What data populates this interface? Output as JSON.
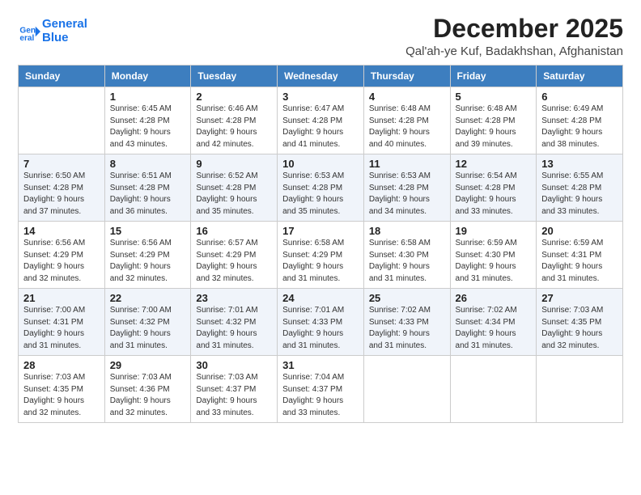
{
  "header": {
    "logo_line1": "General",
    "logo_line2": "Blue",
    "title": "December 2025",
    "subtitle": "Qal'ah-ye Kuf, Badakhshan, Afghanistan"
  },
  "days_of_week": [
    "Sunday",
    "Monday",
    "Tuesday",
    "Wednesday",
    "Thursday",
    "Friday",
    "Saturday"
  ],
  "weeks": [
    [
      {
        "day": "",
        "info": ""
      },
      {
        "day": "1",
        "info": "Sunrise: 6:45 AM\nSunset: 4:28 PM\nDaylight: 9 hours\nand 43 minutes."
      },
      {
        "day": "2",
        "info": "Sunrise: 6:46 AM\nSunset: 4:28 PM\nDaylight: 9 hours\nand 42 minutes."
      },
      {
        "day": "3",
        "info": "Sunrise: 6:47 AM\nSunset: 4:28 PM\nDaylight: 9 hours\nand 41 minutes."
      },
      {
        "day": "4",
        "info": "Sunrise: 6:48 AM\nSunset: 4:28 PM\nDaylight: 9 hours\nand 40 minutes."
      },
      {
        "day": "5",
        "info": "Sunrise: 6:48 AM\nSunset: 4:28 PM\nDaylight: 9 hours\nand 39 minutes."
      },
      {
        "day": "6",
        "info": "Sunrise: 6:49 AM\nSunset: 4:28 PM\nDaylight: 9 hours\nand 38 minutes."
      }
    ],
    [
      {
        "day": "7",
        "info": "Sunrise: 6:50 AM\nSunset: 4:28 PM\nDaylight: 9 hours\nand 37 minutes."
      },
      {
        "day": "8",
        "info": "Sunrise: 6:51 AM\nSunset: 4:28 PM\nDaylight: 9 hours\nand 36 minutes."
      },
      {
        "day": "9",
        "info": "Sunrise: 6:52 AM\nSunset: 4:28 PM\nDaylight: 9 hours\nand 35 minutes."
      },
      {
        "day": "10",
        "info": "Sunrise: 6:53 AM\nSunset: 4:28 PM\nDaylight: 9 hours\nand 35 minutes."
      },
      {
        "day": "11",
        "info": "Sunrise: 6:53 AM\nSunset: 4:28 PM\nDaylight: 9 hours\nand 34 minutes."
      },
      {
        "day": "12",
        "info": "Sunrise: 6:54 AM\nSunset: 4:28 PM\nDaylight: 9 hours\nand 33 minutes."
      },
      {
        "day": "13",
        "info": "Sunrise: 6:55 AM\nSunset: 4:28 PM\nDaylight: 9 hours\nand 33 minutes."
      }
    ],
    [
      {
        "day": "14",
        "info": "Sunrise: 6:56 AM\nSunset: 4:29 PM\nDaylight: 9 hours\nand 32 minutes."
      },
      {
        "day": "15",
        "info": "Sunrise: 6:56 AM\nSunset: 4:29 PM\nDaylight: 9 hours\nand 32 minutes."
      },
      {
        "day": "16",
        "info": "Sunrise: 6:57 AM\nSunset: 4:29 PM\nDaylight: 9 hours\nand 32 minutes."
      },
      {
        "day": "17",
        "info": "Sunrise: 6:58 AM\nSunset: 4:29 PM\nDaylight: 9 hours\nand 31 minutes."
      },
      {
        "day": "18",
        "info": "Sunrise: 6:58 AM\nSunset: 4:30 PM\nDaylight: 9 hours\nand 31 minutes."
      },
      {
        "day": "19",
        "info": "Sunrise: 6:59 AM\nSunset: 4:30 PM\nDaylight: 9 hours\nand 31 minutes."
      },
      {
        "day": "20",
        "info": "Sunrise: 6:59 AM\nSunset: 4:31 PM\nDaylight: 9 hours\nand 31 minutes."
      }
    ],
    [
      {
        "day": "21",
        "info": "Sunrise: 7:00 AM\nSunset: 4:31 PM\nDaylight: 9 hours\nand 31 minutes."
      },
      {
        "day": "22",
        "info": "Sunrise: 7:00 AM\nSunset: 4:32 PM\nDaylight: 9 hours\nand 31 minutes."
      },
      {
        "day": "23",
        "info": "Sunrise: 7:01 AM\nSunset: 4:32 PM\nDaylight: 9 hours\nand 31 minutes."
      },
      {
        "day": "24",
        "info": "Sunrise: 7:01 AM\nSunset: 4:33 PM\nDaylight: 9 hours\nand 31 minutes."
      },
      {
        "day": "25",
        "info": "Sunrise: 7:02 AM\nSunset: 4:33 PM\nDaylight: 9 hours\nand 31 minutes."
      },
      {
        "day": "26",
        "info": "Sunrise: 7:02 AM\nSunset: 4:34 PM\nDaylight: 9 hours\nand 31 minutes."
      },
      {
        "day": "27",
        "info": "Sunrise: 7:03 AM\nSunset: 4:35 PM\nDaylight: 9 hours\nand 32 minutes."
      }
    ],
    [
      {
        "day": "28",
        "info": "Sunrise: 7:03 AM\nSunset: 4:35 PM\nDaylight: 9 hours\nand 32 minutes."
      },
      {
        "day": "29",
        "info": "Sunrise: 7:03 AM\nSunset: 4:36 PM\nDaylight: 9 hours\nand 32 minutes."
      },
      {
        "day": "30",
        "info": "Sunrise: 7:03 AM\nSunset: 4:37 PM\nDaylight: 9 hours\nand 33 minutes."
      },
      {
        "day": "31",
        "info": "Sunrise: 7:04 AM\nSunset: 4:37 PM\nDaylight: 9 hours\nand 33 minutes."
      },
      {
        "day": "",
        "info": ""
      },
      {
        "day": "",
        "info": ""
      },
      {
        "day": "",
        "info": ""
      }
    ]
  ]
}
